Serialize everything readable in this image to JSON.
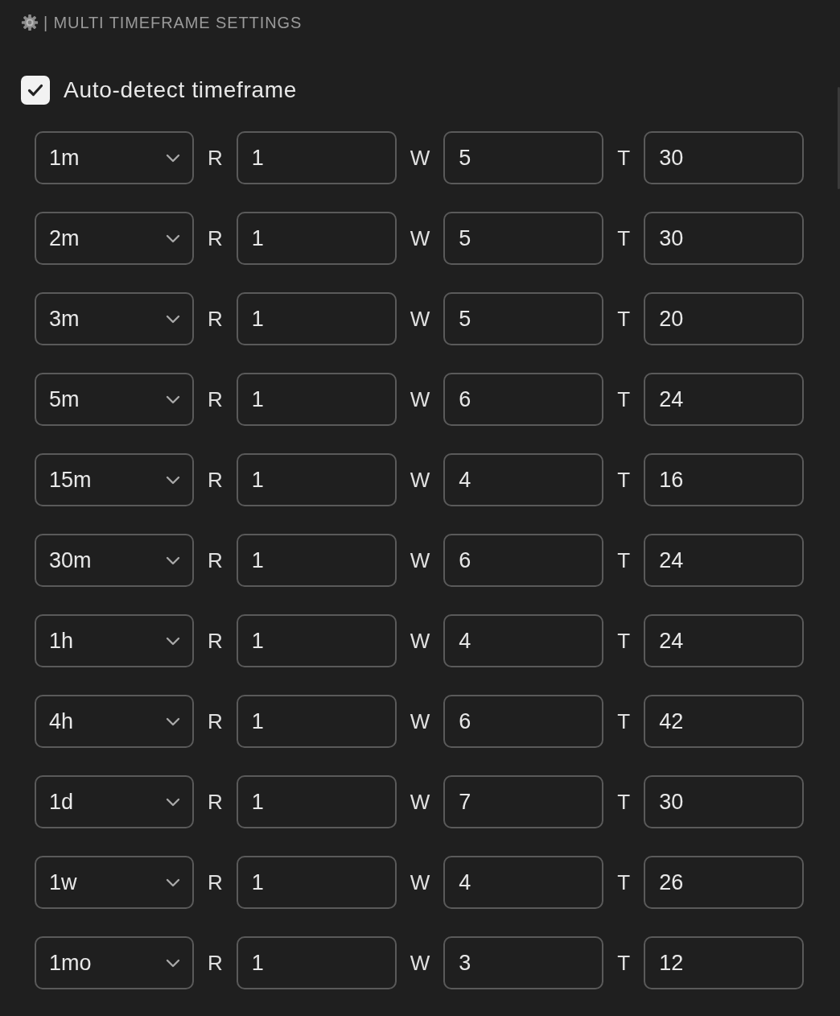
{
  "header": {
    "title": "| MULTI TIMEFRAME SETTINGS"
  },
  "auto_detect": {
    "label": "Auto-detect timeframe",
    "checked": true
  },
  "rows": [
    {
      "timeframe": "1m",
      "params": [
        {
          "label": "R",
          "value": "1"
        },
        {
          "label": "W",
          "value": "5"
        },
        {
          "label": "T",
          "value": "30"
        }
      ]
    },
    {
      "timeframe": "2m",
      "params": [
        {
          "label": "R",
          "value": "1"
        },
        {
          "label": "W",
          "value": "5"
        },
        {
          "label": "T",
          "value": "30"
        }
      ]
    },
    {
      "timeframe": "3m",
      "params": [
        {
          "label": "R",
          "value": "1"
        },
        {
          "label": "W",
          "value": "5"
        },
        {
          "label": "T",
          "value": "20"
        }
      ]
    },
    {
      "timeframe": "5m",
      "params": [
        {
          "label": "R",
          "value": "1"
        },
        {
          "label": "W",
          "value": "6"
        },
        {
          "label": "T",
          "value": "24"
        }
      ]
    },
    {
      "timeframe": "15m",
      "params": [
        {
          "label": "R",
          "value": "1"
        },
        {
          "label": "W",
          "value": "4"
        },
        {
          "label": "T",
          "value": "16"
        }
      ]
    },
    {
      "timeframe": "30m",
      "params": [
        {
          "label": "R",
          "value": "1"
        },
        {
          "label": "W",
          "value": "6"
        },
        {
          "label": "T",
          "value": "24"
        }
      ]
    },
    {
      "timeframe": "1h",
      "params": [
        {
          "label": "R",
          "value": "1"
        },
        {
          "label": "W",
          "value": "4"
        },
        {
          "label": "T",
          "value": "24"
        }
      ]
    },
    {
      "timeframe": "4h",
      "params": [
        {
          "label": "R",
          "value": "1"
        },
        {
          "label": "W",
          "value": "6"
        },
        {
          "label": "T",
          "value": "42"
        }
      ]
    },
    {
      "timeframe": "1d",
      "params": [
        {
          "label": "R",
          "value": "1"
        },
        {
          "label": "W",
          "value": "7"
        },
        {
          "label": "T",
          "value": "30"
        }
      ]
    },
    {
      "timeframe": "1w",
      "params": [
        {
          "label": "R",
          "value": "1"
        },
        {
          "label": "W",
          "value": "4"
        },
        {
          "label": "T",
          "value": "26"
        }
      ]
    },
    {
      "timeframe": "1mo",
      "params": [
        {
          "label": "R",
          "value": "1"
        },
        {
          "label": "W",
          "value": "3"
        },
        {
          "label": "T",
          "value": "12"
        }
      ]
    }
  ]
}
